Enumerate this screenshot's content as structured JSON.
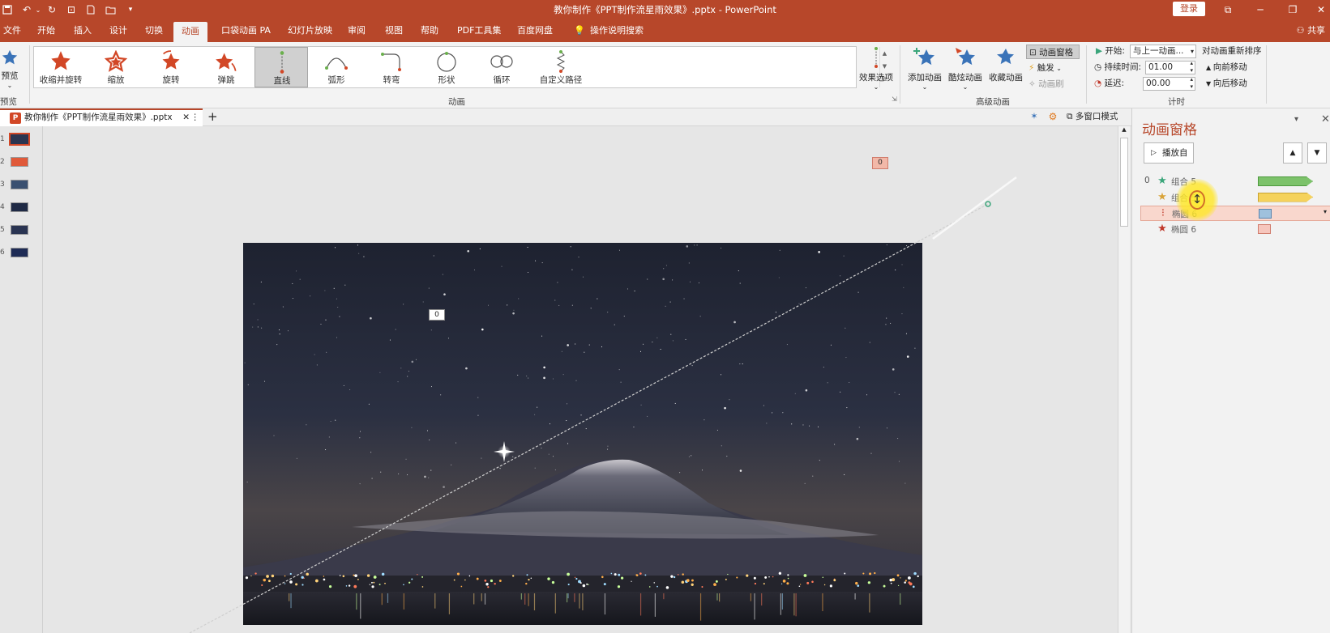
{
  "titlebar": {
    "title": "教你制作《PPT制作流星雨效果》.pptx  -  PowerPoint",
    "login": "登录",
    "qat_icons": [
      "save-icon",
      "undo-icon",
      "redo-icon",
      "presenter-icon",
      "new-file-icon",
      "open-icon",
      "customize-icon"
    ]
  },
  "tabs": [
    "文件",
    "开始",
    "插入",
    "设计",
    "切换",
    "动画",
    "口袋动画 PA",
    "幻灯片放映",
    "审阅",
    "视图",
    "帮助",
    "PDF工具集",
    "百度网盘",
    "操作说明搜索"
  ],
  "active_tab": "动画",
  "share": "共享",
  "ribbon": {
    "preview_label": "预览",
    "preview_group": "预览",
    "animations": [
      "收缩并旋转",
      "缩放",
      "旋转",
      "弹跳",
      "直线",
      "弧形",
      "转弯",
      "形状",
      "循环",
      "自定义路径"
    ],
    "selected_animation": "直线",
    "effect_options": "效果选项",
    "animation_group": "动画",
    "add_animation": "添加动画",
    "cool_animation": "酷炫动画",
    "collect_animation": "收藏动画",
    "animation_pane_btn": "动画窗格",
    "trigger": "触发",
    "animation_painter": "动画刷",
    "advanced_group": "高级动画",
    "start_label": "开始:",
    "start_value": "与上一动画...",
    "duration_label": "持续时间:",
    "duration_value": "01.00",
    "delay_label": "延迟:",
    "delay_value": "00.00",
    "reorder_title": "对动画重新排序",
    "move_earlier": "向前移动",
    "move_later": "向后移动",
    "timing_group": "计时"
  },
  "docstrip": {
    "doc_tab": "教你制作《PPT制作流星雨效果》.pptx",
    "multiwindow": "多窗口模式"
  },
  "thumbnails": [
    {
      "num": "1",
      "color": "#2b3550",
      "selected": true
    },
    {
      "num": "2",
      "color": "#e05a3a",
      "selected": false
    },
    {
      "num": "3",
      "color": "#3a5070",
      "selected": false
    },
    {
      "num": "4",
      "color": "#1f2a45",
      "selected": false
    },
    {
      "num": "5",
      "color": "#2a3452",
      "selected": false
    },
    {
      "num": "6",
      "color": "#1e2b55",
      "selected": false
    }
  ],
  "canvas": {
    "tag_top": "0",
    "tag_star": "0"
  },
  "pane": {
    "title": "动画窗格",
    "play_from": "播放自",
    "rows": [
      {
        "num": "0",
        "icon": "★",
        "icon_color": "#3aa57a",
        "name": "组合 5",
        "bar_color": "#7cc26a",
        "bar_border": "#4e9a3e",
        "bar_kind": "arrow"
      },
      {
        "num": "",
        "icon": "★",
        "icon_color": "#d9a43a",
        "name": "组合 5",
        "bar_color": "#f5d25c",
        "bar_border": "#c9a331",
        "bar_kind": "arrow"
      },
      {
        "num": "",
        "icon": "⁝",
        "icon_color": "#c0392b",
        "name": "椭圆 6",
        "bar_color": "#9fc1dd",
        "bar_border": "#5a86b0",
        "bar_kind": "box"
      },
      {
        "num": "",
        "icon": "★",
        "icon_color": "#c0392b",
        "name": "椭圆 6",
        "bar_color": "#f6c6bd",
        "bar_border": "#d07c6c",
        "bar_kind": "box"
      }
    ]
  }
}
